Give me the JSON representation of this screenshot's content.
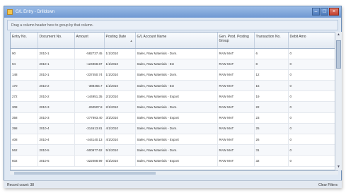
{
  "window": {
    "title": "G/L Entry - Drilldown"
  },
  "group_panel": {
    "hint": "Drag a column header here to group by that column."
  },
  "grid": {
    "columns": [
      "Entry No.",
      "Document No.",
      "Amount",
      "Posting Date",
      "G/L Account Name",
      "Gen. Prod. Posting Group",
      "Transaction No.",
      "Debit Amo"
    ],
    "rows": [
      [
        "90",
        "2010-1",
        "-582737.45",
        "1/1/2010",
        "Sales, Raw Materials - Dom.",
        "RAW MAT",
        "6",
        "0"
      ],
      [
        "94",
        "2010-1",
        "-124968.87",
        "1/1/2010",
        "Sales, Raw Materials - EU",
        "RAW MAT",
        "8",
        "0"
      ],
      [
        "148",
        "2010-1",
        "-337450.74",
        "1/1/2010",
        "Sales, Raw Materials - Dom.",
        "RAW MAT",
        "12",
        "0"
      ],
      [
        "170",
        "2010-2",
        "-388465.7",
        "1/1/2010",
        "Sales, Raw Materials - EU",
        "RAW MAT",
        "16",
        "0"
      ],
      [
        "272",
        "2010-2",
        "-144951.35",
        "2/1/2010",
        "Sales, Raw Materials - Export",
        "RAW MAT",
        "19",
        "0"
      ],
      [
        "308",
        "2010-3",
        "-260507.8",
        "2/1/2010",
        "Sales, Raw Materials - Dom.",
        "RAW MAT",
        "22",
        "0"
      ],
      [
        "358",
        "2010-3",
        "-277893.40",
        "3/1/2010",
        "Sales, Raw Materials - Export",
        "RAW MAT",
        "23",
        "0"
      ],
      [
        "398",
        "2010-4",
        "-314613.81",
        "4/1/2010",
        "Sales, Raw Materials - Dom.",
        "RAW MAT",
        "25",
        "0"
      ],
      [
        "408",
        "2010-4",
        "-444140.13",
        "4/1/2010",
        "Sales, Raw Materials - Export",
        "RAW MAT",
        "26",
        "0"
      ],
      [
        "562",
        "2010-5",
        "-500977.62",
        "5/1/2010",
        "Sales, Raw Materials - Dom.",
        "RAW MAT",
        "31",
        "0"
      ],
      [
        "602",
        "2010-5",
        "-322088.99",
        "5/1/2010",
        "Sales, Raw Materials - Export",
        "RAW MAT",
        "32",
        "0"
      ]
    ]
  },
  "status": {
    "record_count": "Record count: 38",
    "clear_filters": "Clear Filters"
  },
  "icons": {
    "app": "document-icon",
    "sort": "sort-ascending-icon"
  },
  "colors": {
    "titlebar": "#6f98d2",
    "close_button": "#c2402e",
    "grid_border": "#9cb0c9"
  }
}
